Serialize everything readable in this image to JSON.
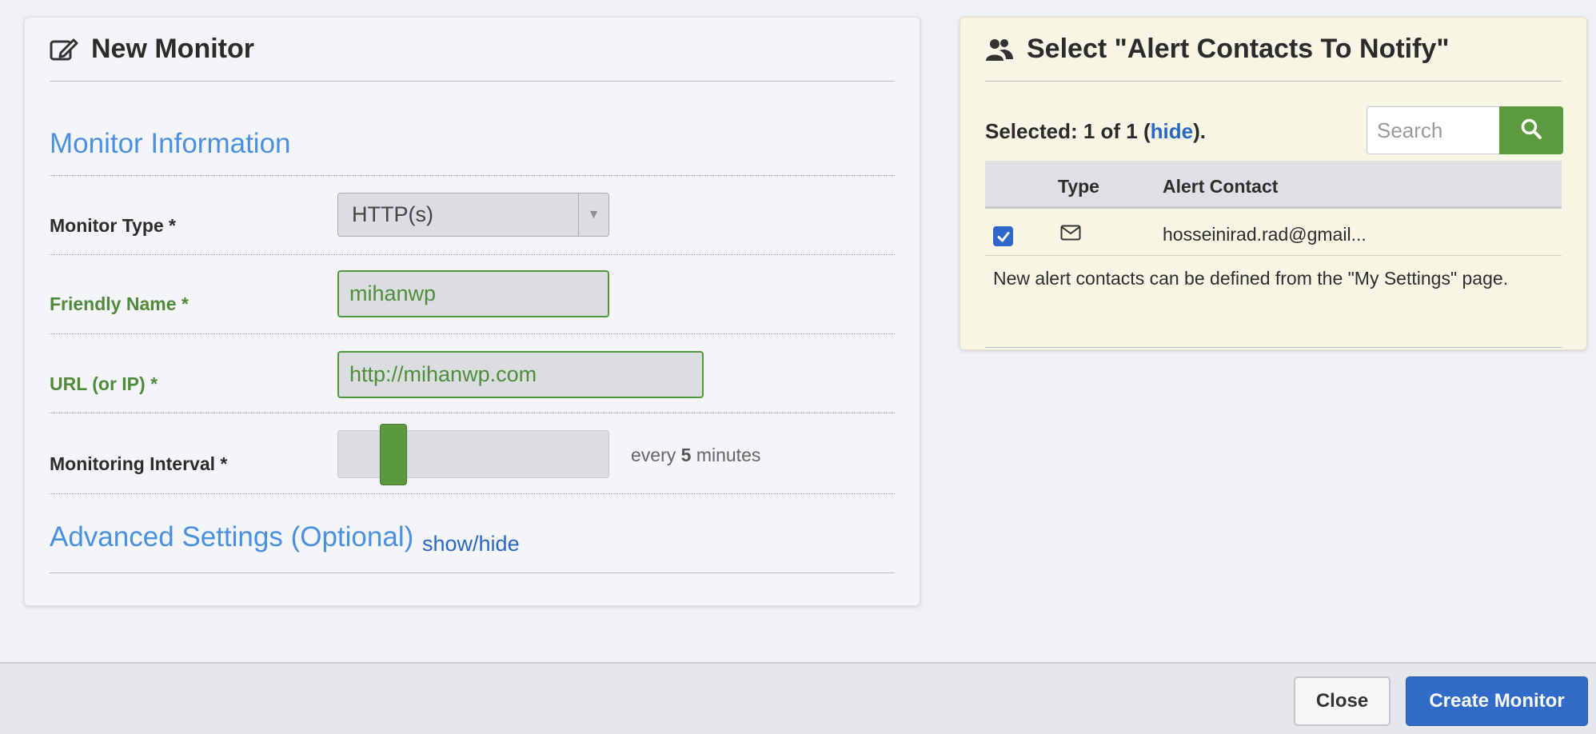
{
  "new_monitor": {
    "title": "New Monitor",
    "icon": "edit-icon",
    "section_title": "Monitor Information",
    "monitor_type": {
      "label": "Monitor Type *",
      "value": "HTTP(s)"
    },
    "friendly_name": {
      "label": "Friendly Name *",
      "value": "mihanwp"
    },
    "url": {
      "label": "URL (or IP) *",
      "value": "http://mihanwp.com"
    },
    "interval": {
      "label": "Monitoring Interval *",
      "prefix": "every",
      "value": "5",
      "suffix": "minutes"
    },
    "advanced": {
      "title": "Advanced Settings (Optional)",
      "toggle": "show/hide"
    }
  },
  "alert_contacts": {
    "title": "Select \"Alert Contacts To Notify\"",
    "icon": "users-icon",
    "selected_prefix": "Selected: 1 of 1 (",
    "hide_link": "hide",
    "selected_suffix": ").",
    "search_placeholder": "Search",
    "columns": {
      "type": "Type",
      "contact": "Alert Contact"
    },
    "rows": [
      {
        "checked": true,
        "type_icon": "mail-icon",
        "contact": "hosseinirad.rad@gmail..."
      }
    ],
    "note": "New alert contacts can be defined from the \"My Settings\" page."
  },
  "footer": {
    "close": "Close",
    "create": "Create Monitor"
  },
  "colors": {
    "accent_blue": "#4a90e2",
    "link_blue": "#2868c4",
    "valid_green": "#4e9a3a",
    "primary_button": "#2f6bc7",
    "search_button": "#5b9a3f",
    "alert_panel_bg": "#f7f5e3"
  }
}
